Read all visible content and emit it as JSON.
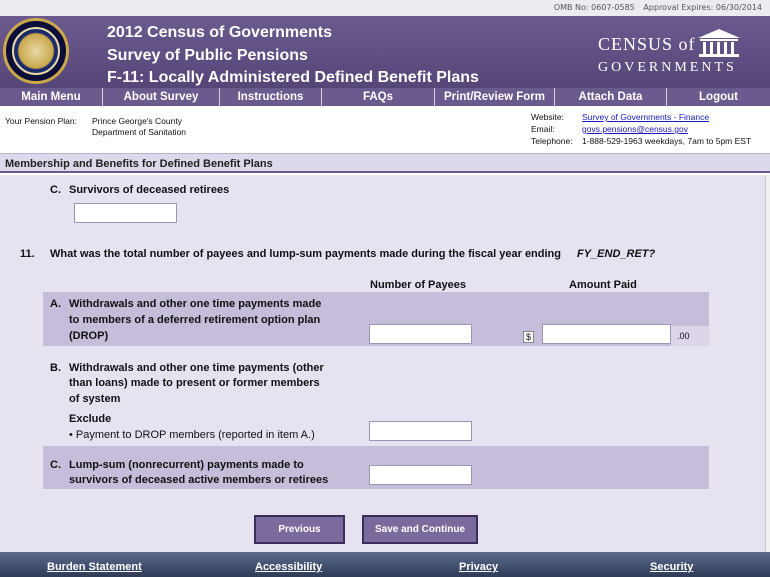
{
  "topbar": {
    "omb": "OMB No:  0607-0585",
    "approval": "Approval Expires:  06/30/2014"
  },
  "header": {
    "title1": "2012 Census of Governments",
    "title2": "Survey of Public Pensions",
    "title3": "F-11:  Locally Administered Defined Benefit Plans",
    "logo_line1": "CENSUS of",
    "logo_line2": "GOVERNMENTS"
  },
  "nav": [
    "Main Menu",
    "About Survey",
    "Instructions",
    "FAQs",
    "Print/Review Form",
    "Attach Data",
    "Logout"
  ],
  "plan": {
    "label": "Your Pension Plan:",
    "line1": "Prince George's County",
    "line2": "Department of Sanitation"
  },
  "contact": {
    "website_label": "Website:",
    "website": "Survey of Governments - Finance",
    "email_label": "Email:",
    "email": "govs.pensions@census.gov",
    "phone_label": "Telephone:",
    "phone": "1-888-529-1963  weekdays, 7am to 5pm EST"
  },
  "section_title": "Membership and Benefits for Defined Benefit Plans",
  "item_c_prev": {
    "letter": "C.",
    "label": "Survivors of deceased retirees",
    "value": ""
  },
  "q11": {
    "number": "11.",
    "text": "What was the total number of payees and lump-sum payments made during the fiscal year ending",
    "var": "FY_END_RET?",
    "col_payees": "Number of Payees",
    "col_amount": "Amount Paid",
    "a": {
      "letter": "A.",
      "line1": "Withdrawals and other one time payments made",
      "line2": "to members of a deferred retirement option plan",
      "line3": "(DROP)",
      "payees": "",
      "amount": "",
      "dollar": "$",
      "cents": ".00"
    },
    "b": {
      "letter": "B.",
      "line1": "Withdrawals and other one time payments (other",
      "line2": "than loans) made to present or former members",
      "line3": "of system",
      "exclude": "Exclude",
      "bullet": "•  Payment to DROP members (reported in item A.)",
      "payees": ""
    },
    "c": {
      "letter": "C.",
      "line1": "Lump-sum (nonrecurrent) payments made to",
      "line2": "survivors of deceased active members or retirees",
      "payees": ""
    }
  },
  "buttons": {
    "previous": "Previous",
    "save": "Save and Continue"
  },
  "footer": [
    "Burden Statement",
    "Accessibility",
    "Privacy",
    "Security"
  ]
}
